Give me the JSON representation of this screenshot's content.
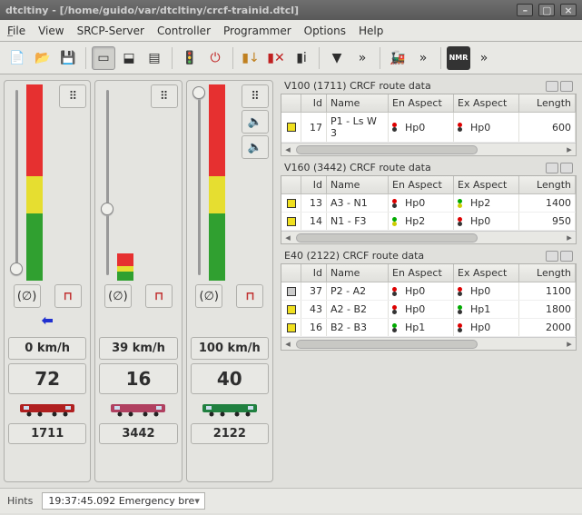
{
  "title": "dtcltiny - [/home/guido/var/dtcltiny/crcf-trainid.dtcl]",
  "menu": {
    "file": "File",
    "view": "View",
    "srcp": "SRCP-Server",
    "controller": "Controller",
    "programmer": "Programmer",
    "options": "Options",
    "help": "Help"
  },
  "locos": [
    {
      "speed": "0 km/h",
      "addr": "72",
      "dcc": "1711",
      "thumbTop": 196,
      "color": "#b02020",
      "barTop": 0
    },
    {
      "speed": "39 km/h",
      "addr": "16",
      "dcc": "3442",
      "thumbTop": 130,
      "color": "#b04060",
      "barTop": 40
    },
    {
      "speed": "100 km/h",
      "addr": "40",
      "dcc": "2122",
      "thumbTop": 2,
      "color": "#208040",
      "barTop": 0
    }
  ],
  "groups": [
    {
      "title": "V100 (1711) CRCF route data",
      "rows": [
        {
          "sq": "y",
          "id": "17",
          "name": "P1 - Ls W 3",
          "ea_c": [
            "dr",
            "dk"
          ],
          "ea": "Hp0",
          "xa_c": [
            "dr",
            "dk"
          ],
          "xa": "Hp0",
          "len": "600"
        }
      ]
    },
    {
      "title": "V160 (3442) CRCF route data",
      "rows": [
        {
          "sq": "y",
          "id": "13",
          "name": "A3 - N1",
          "ea_c": [
            "dr",
            "dk"
          ],
          "ea": "Hp0",
          "xa_c": [
            "dg",
            "dy"
          ],
          "xa": "Hp2",
          "len": "1400"
        },
        {
          "sq": "y",
          "id": "14",
          "name": "N1 - F3",
          "ea_c": [
            "dg",
            "dy"
          ],
          "ea": "Hp2",
          "xa_c": [
            "dr",
            "dk"
          ],
          "xa": "Hp0",
          "len": "950"
        }
      ]
    },
    {
      "title": "E40 (2122) CRCF route data",
      "rows": [
        {
          "sq": "g",
          "id": "37",
          "name": "P2 - A2",
          "ea_c": [
            "dr",
            "dk"
          ],
          "ea": "Hp0",
          "xa_c": [
            "dr",
            "dk"
          ],
          "xa": "Hp0",
          "len": "1100"
        },
        {
          "sq": "y",
          "id": "43",
          "name": "A2 - B2",
          "ea_c": [
            "dr",
            "dk"
          ],
          "ea": "Hp0",
          "xa_c": [
            "dg",
            "dk"
          ],
          "xa": "Hp1",
          "len": "1800"
        },
        {
          "sq": "y",
          "id": "16",
          "name": "B2 - B3",
          "ea_c": [
            "dg",
            "dk"
          ],
          "ea": "Hp1",
          "xa_c": [
            "dr",
            "dk"
          ],
          "xa": "Hp0",
          "len": "2000"
        }
      ]
    }
  ],
  "hdr": {
    "id": "Id",
    "name": "Name",
    "ea": "En Aspect",
    "xa": "Ex Aspect",
    "len": "Length"
  },
  "status": {
    "hints": "Hints",
    "log": "19:37:45.092 Emergency bre"
  }
}
